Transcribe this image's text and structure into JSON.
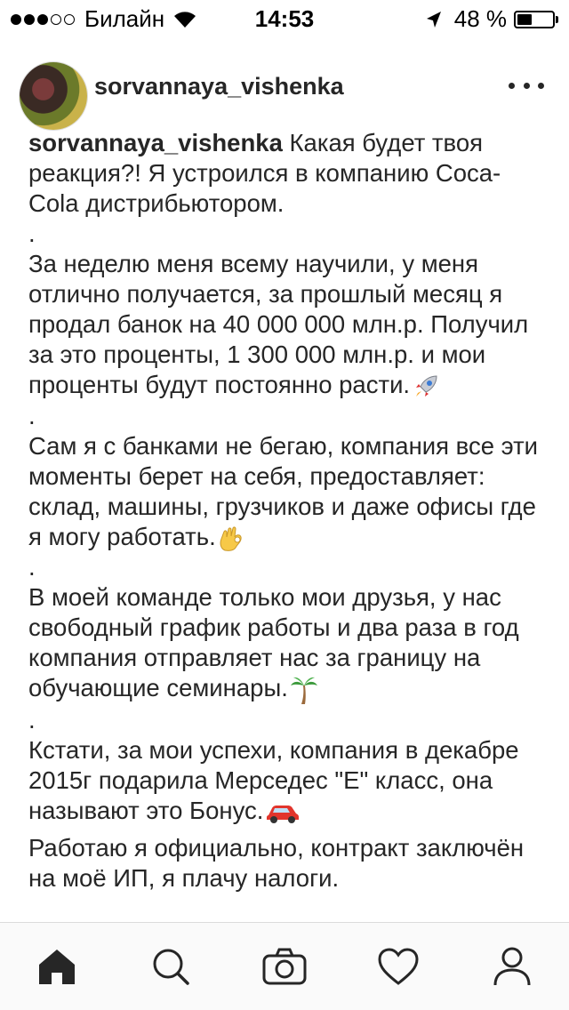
{
  "status_bar": {
    "carrier": "Билайн",
    "time": "14:53",
    "battery": "48 %",
    "battery_level": 0.48,
    "signal_bars": 3,
    "signal_total": 5
  },
  "header": {
    "username": "sorvannaya_vishenka",
    "more_icon": "more-horizontal-icon"
  },
  "caption": {
    "username": "sorvannaya_vishenka",
    "intro": "Какая будет твоя реакция?! Я устроился в компанию Coca-Cola дистрибьютором.",
    "dot": ".",
    "para1": "За неделю меня всему научили, у меня отлично получается, за прошлый месяц я продал банок на 40 000 000 млн.р. Получил за это проценты, 1 300 000 млн.р. и мои проценты будут постоянно расти.",
    "para2": "Сам я с банками не бегаю, компания все эти моменты берет на себя, предоставляет: склад, машины, грузчиков и даже офисы где я могу работать.",
    "para3": "В моей команде только мои друзья, у нас свободный график работы и два раза в год компания отправляет нас за границу на обучающие семинары.",
    "para4": "Кстати, за мои успехи, компания в декабре 2015г подарила Мерседес \"Е\" класс, она называют это Бонус.",
    "para5": "Работаю я официально, контракт заключён на моё ИП, я плачу налоги.",
    "emojis": [
      "rocket-icon",
      "ok-hand-icon",
      "palm-tree-icon",
      "car-icon"
    ]
  },
  "tab_bar": {
    "items": [
      "home-icon",
      "search-icon",
      "camera-icon",
      "heart-icon",
      "profile-icon"
    ],
    "active": "home-icon"
  }
}
